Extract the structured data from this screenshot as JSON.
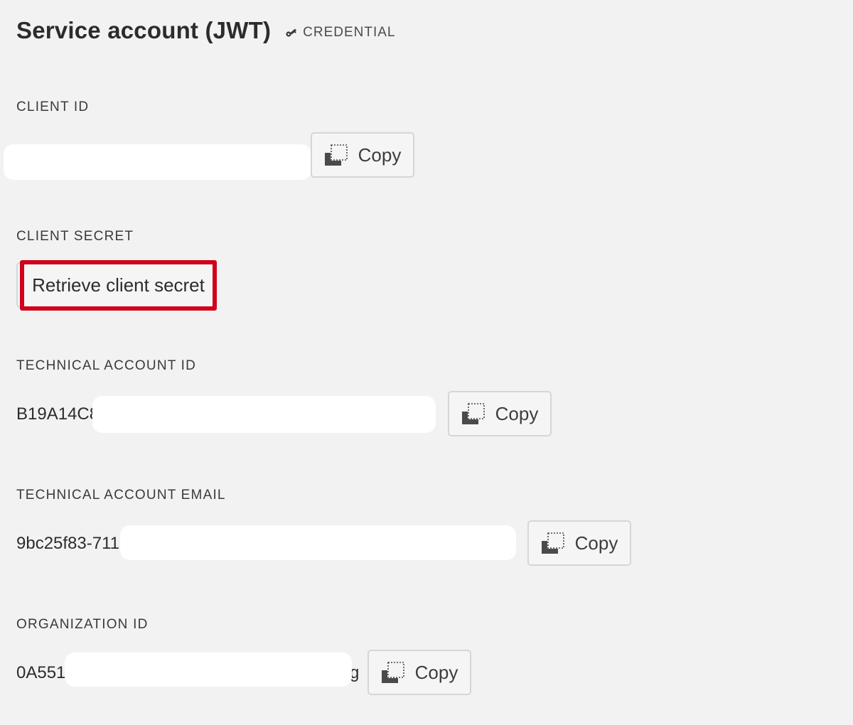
{
  "header": {
    "title": "Service account (JWT)",
    "badge": "CREDENTIAL",
    "badge_icon": "key-icon"
  },
  "fields": {
    "client_id": {
      "label": "CLIENT ID",
      "value": "",
      "copy_label": "Copy"
    },
    "client_secret": {
      "label": "CLIENT SECRET",
      "button_label": "Retrieve client secret",
      "highlight_color": "#d0021b"
    },
    "technical_account_id": {
      "label": "TECHNICAL ACCOUNT ID",
      "value": "B19A14C8",
      "copy_label": "Copy"
    },
    "technical_account_email": {
      "label": "TECHNICAL ACCOUNT EMAIL",
      "value": "9bc25f83-711",
      "copy_label": "Copy"
    },
    "organization_id": {
      "label": "ORGANIZATION ID",
      "value": "0A551",
      "trailing": "g",
      "copy_label": "Copy"
    }
  },
  "icons": {
    "copy": "copy-icon"
  }
}
